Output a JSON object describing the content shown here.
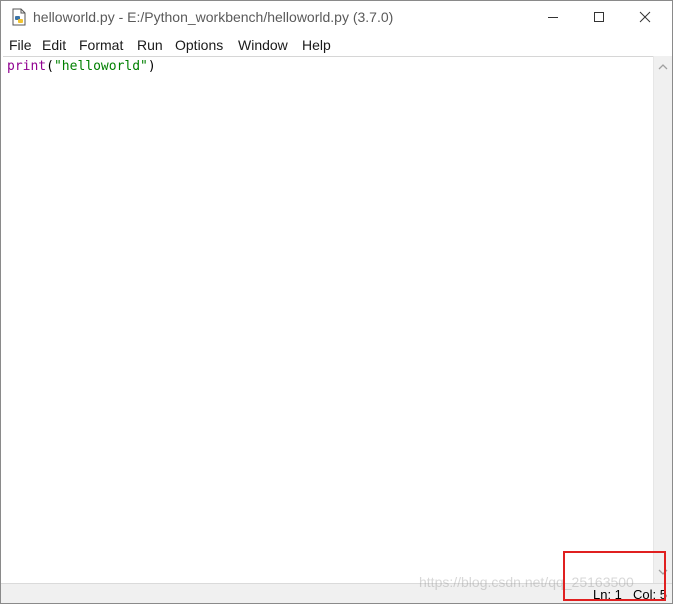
{
  "window": {
    "title": "helloworld.py - E:/Python_workbench/helloworld.py (3.7.0)",
    "icon": "python-file-icon"
  },
  "window_controls": {
    "minimize_icon": "minimize-icon",
    "maximize_icon": "maximize-icon",
    "close_icon": "close-icon"
  },
  "menu": {
    "items": [
      {
        "label": "File"
      },
      {
        "label": "Edit"
      },
      {
        "label": "Format"
      },
      {
        "label": "Run"
      },
      {
        "label": "Options"
      },
      {
        "label": "Window"
      },
      {
        "label": "Help"
      }
    ]
  },
  "editor": {
    "line1": {
      "builtin": "print",
      "open_paren": "(",
      "string": "\"helloworld\"",
      "close_paren": ")"
    },
    "colors": {
      "builtin": "#900090",
      "string": "#008000"
    }
  },
  "statusbar": {
    "ln": "Ln: 1",
    "col": "Col: 5"
  },
  "watermark": {
    "text": "https://blog.csdn.net/qq_25163500"
  },
  "annotation": {
    "color": "#e02020"
  }
}
